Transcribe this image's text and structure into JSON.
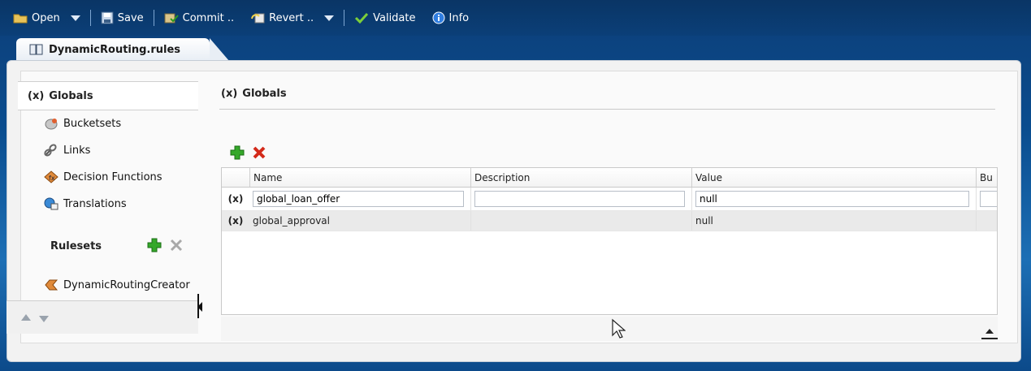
{
  "toolbar": {
    "open_label": "Open",
    "save_label": "Save",
    "commit_label": "Commit ..",
    "revert_label": "Revert ..",
    "validate_label": "Validate",
    "info_label": "Info"
  },
  "document_tab": {
    "label": "DynamicRouting.rules"
  },
  "nav": {
    "selected_label": "Globals",
    "selected_prefix": "(x)",
    "items": [
      {
        "label": "Bucketsets",
        "icon": "bucketsets-icon"
      },
      {
        "label": "Links",
        "icon": "links-icon"
      },
      {
        "label": "Decision Functions",
        "icon": "decision-functions-icon"
      },
      {
        "label": "Translations",
        "icon": "translations-icon"
      }
    ],
    "rulesets_label": "Rulesets",
    "rulesets": [
      {
        "label": "DynamicRoutingCreator",
        "icon": "ruleset-icon"
      }
    ]
  },
  "content": {
    "title_prefix": "(x)",
    "title": "Globals",
    "table": {
      "columns": [
        "Name",
        "Description",
        "Value",
        "Bu"
      ],
      "rows": [
        {
          "marker": "(x)",
          "name": "global_loan_offer",
          "description": "",
          "value": "null",
          "editing": true
        },
        {
          "marker": "(x)",
          "name": "global_approval",
          "description": "",
          "value": "null",
          "editing": false
        }
      ]
    }
  },
  "colors": {
    "toolbar_bg": "#0b3f78",
    "accent_green": "#2e9b1f",
    "delete_red": "#d32a1a"
  }
}
